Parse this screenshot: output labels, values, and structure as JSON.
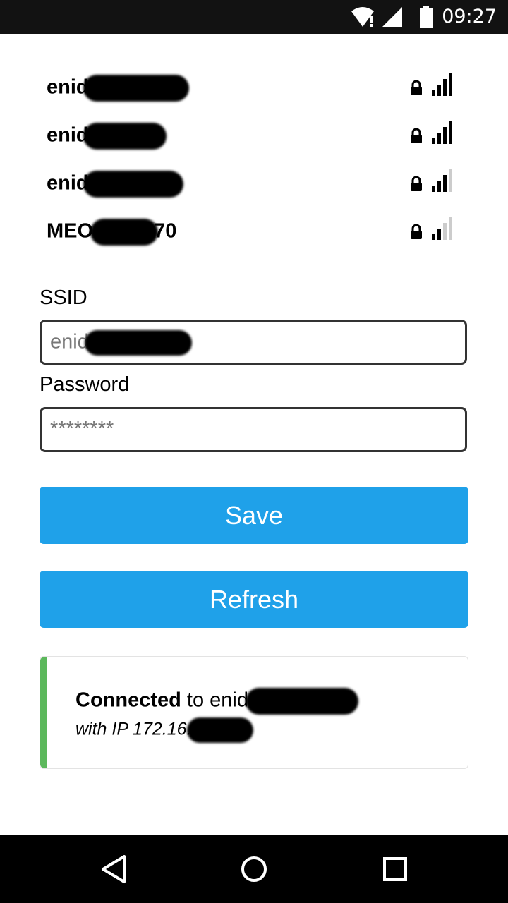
{
  "status_bar": {
    "time": "09:27"
  },
  "networks": [
    {
      "name_prefix": "enid",
      "name_suffix": "",
      "signal": 4
    },
    {
      "name_prefix": "enid",
      "name_suffix": "",
      "signal": 4
    },
    {
      "name_prefix": "enid",
      "name_suffix": "",
      "signal": 3
    },
    {
      "name_prefix": "MEO",
      "name_suffix": "70",
      "signal": 2
    }
  ],
  "form": {
    "ssid_label": "SSID",
    "ssid_value": "enid",
    "password_label": "Password",
    "password_value": "********"
  },
  "buttons": {
    "save": "Save",
    "refresh": "Refresh"
  },
  "status": {
    "connected_bold": "Connected",
    "connected_to": " to enid",
    "ip_text": "with IP 172.16."
  },
  "colors": {
    "button": "#1fa1e9",
    "accent": "#5cb85c"
  }
}
